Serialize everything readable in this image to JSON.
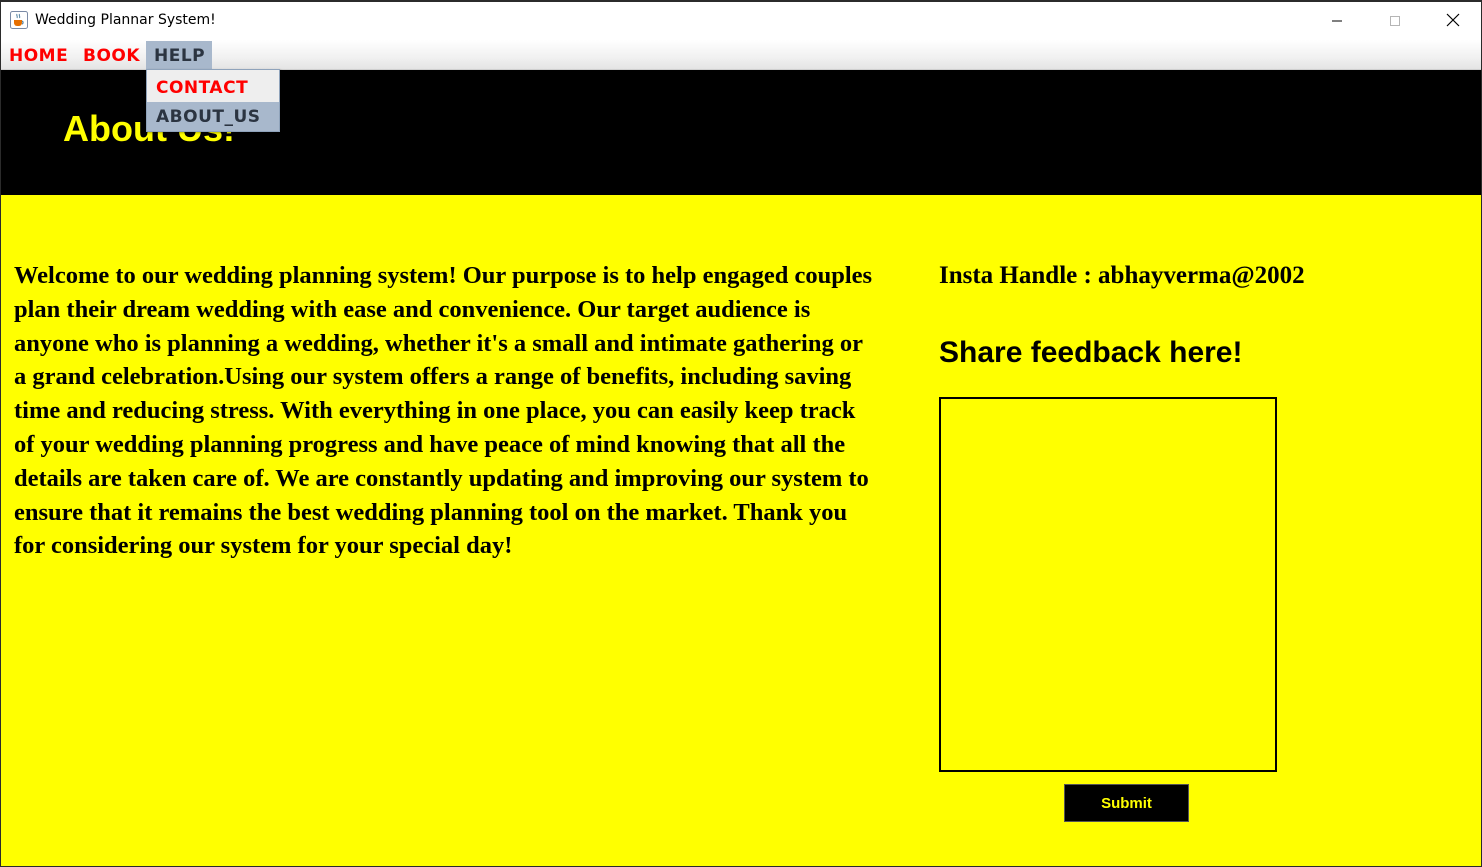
{
  "window": {
    "title": "Wedding Plannar System!"
  },
  "menu": {
    "home": "HOME",
    "book": "BOOK",
    "help": "HELP"
  },
  "dropdown": {
    "contact": "CONTACT",
    "about_us": "ABOUT_US"
  },
  "header": {
    "title": "About Us!"
  },
  "about": {
    "text": "Welcome to our wedding planning system! Our purpose is to help engaged couples plan their dream wedding with ease and convenience. Our target audience is anyone who is planning a wedding, whether it's a small and intimate gathering or a grand celebration.Using our system offers a range of benefits, including saving time and reducing stress. With everything in one place, you can easily keep track of your wedding planning progress and have peace of mind knowing that all the details are taken care of. We are constantly updating and improving our system to ensure that it remains the best wedding planning tool on the market. Thank you for considering our system for your special day!"
  },
  "sidebar": {
    "insta_handle": "Insta Handle : abhayverma@2002",
    "feedback_title": "Share feedback here!",
    "feedback_value": "",
    "submit_label": "Submit"
  },
  "colors": {
    "background": "#ffff00",
    "header_band": "#000000",
    "title_accent": "#ffff00",
    "menu_text": "#ff0000",
    "menu_selected": "#a8b8cc"
  },
  "icons": {
    "app": "java-coffee-cup-icon",
    "minimize": "minimize-icon",
    "maximize": "maximize-icon",
    "close": "close-icon"
  }
}
